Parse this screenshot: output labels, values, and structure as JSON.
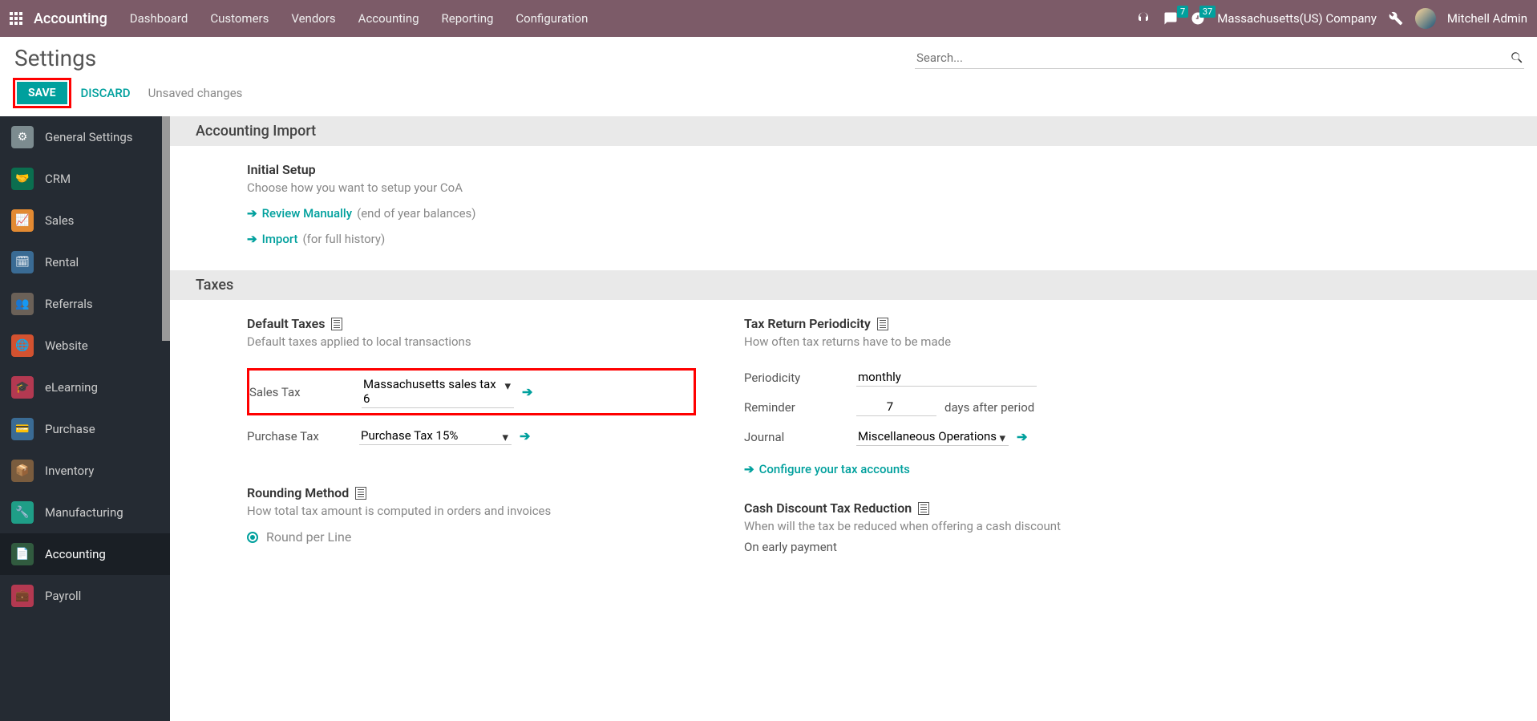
{
  "navbar": {
    "brand": "Accounting",
    "items": [
      "Dashboard",
      "Customers",
      "Vendors",
      "Accounting",
      "Reporting",
      "Configuration"
    ],
    "messages_count": "7",
    "activities_count": "37",
    "company": "Massachusetts(US) Company",
    "user": "Mitchell Admin"
  },
  "controlpanel": {
    "title": "Settings",
    "search_placeholder": "Search...",
    "save": "SAVE",
    "discard": "DISCARD",
    "unsaved": "Unsaved changes"
  },
  "sidebar": [
    {
      "label": "General Settings",
      "color": "#7c8b8f"
    },
    {
      "label": "CRM",
      "color": "#0b6e4f"
    },
    {
      "label": "Sales",
      "color": "#e38a32"
    },
    {
      "label": "Rental",
      "color": "#3a6b94"
    },
    {
      "label": "Referrals",
      "color": "#6b6158"
    },
    {
      "label": "Website",
      "color": "#d35230"
    },
    {
      "label": "eLearning",
      "color": "#b33951"
    },
    {
      "label": "Purchase",
      "color": "#3a6b94"
    },
    {
      "label": "Inventory",
      "color": "#7a5c3e"
    },
    {
      "label": "Manufacturing",
      "color": "#1f9e87"
    },
    {
      "label": "Accounting",
      "color": "#315b3f",
      "active": true
    },
    {
      "label": "Payroll",
      "color": "#b33951"
    }
  ],
  "sections": {
    "import": {
      "header": "Accounting Import",
      "title": "Initial Setup",
      "desc": "Choose how you want to setup your CoA",
      "review": "Review Manually",
      "review_hint": "(end of year balances)",
      "import": "Import",
      "import_hint": "(for full history)"
    },
    "taxes": {
      "header": "Taxes",
      "default_title": "Default Taxes",
      "default_desc": "Default taxes applied to local transactions",
      "sales_label": "Sales Tax",
      "sales_value": "Massachusetts sales tax 6",
      "purchase_label": "Purchase Tax",
      "purchase_value": "Purchase Tax 15%",
      "return_title": "Tax Return Periodicity",
      "return_desc": "How often tax returns have to be made",
      "periodicity_label": "Periodicity",
      "periodicity_value": "monthly",
      "reminder_label": "Reminder",
      "reminder_value": "7",
      "reminder_suffix": "days after period",
      "journal_label": "Journal",
      "journal_value": "Miscellaneous Operations",
      "configure_link": "Configure your tax accounts",
      "rounding_title": "Rounding Method",
      "rounding_desc": "How total tax amount is computed in orders and invoices",
      "rounding_opt": "Round per Line",
      "cash_title": "Cash Discount Tax Reduction",
      "cash_desc": "When will the tax be reduced when offering a cash discount",
      "cash_value": "On early payment"
    }
  }
}
